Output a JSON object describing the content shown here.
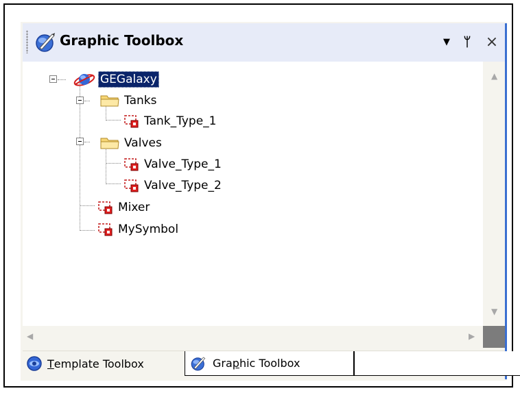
{
  "panel": {
    "title": "Graphic Toolbox",
    "controls": {
      "dropdown": "▼",
      "pin": "ᛘ",
      "close": "×"
    }
  },
  "tree": {
    "nodes": [
      {
        "label": "GEGalaxy",
        "icon": "galaxy-icon",
        "selected": true,
        "expanded": true
      },
      {
        "label": "Tanks",
        "icon": "folder-icon",
        "expanded": true
      },
      {
        "label": "Tank_Type_1",
        "icon": "symbol-icon"
      },
      {
        "label": "Valves",
        "icon": "folder-icon",
        "expanded": true
      },
      {
        "label": "Valve_Type_1",
        "icon": "symbol-icon"
      },
      {
        "label": "Valve_Type_2",
        "icon": "symbol-icon"
      },
      {
        "label": "Mixer",
        "icon": "symbol-icon"
      },
      {
        "label": "MySymbol",
        "icon": "symbol-icon"
      }
    ]
  },
  "tabs": [
    {
      "label_pre": "",
      "label_ul": "T",
      "label_post": "emplate Toolbox",
      "icon": "template-toolbox-icon",
      "active": false
    },
    {
      "label_pre": "Gra",
      "label_ul": "p",
      "label_post": "hic Toolbox",
      "icon": "graphic-toolbox-icon",
      "active": true
    }
  ],
  "colors": {
    "selection": "#0a246a",
    "accent": "#3a6fd1",
    "title_bar": "#e7ebf8"
  }
}
